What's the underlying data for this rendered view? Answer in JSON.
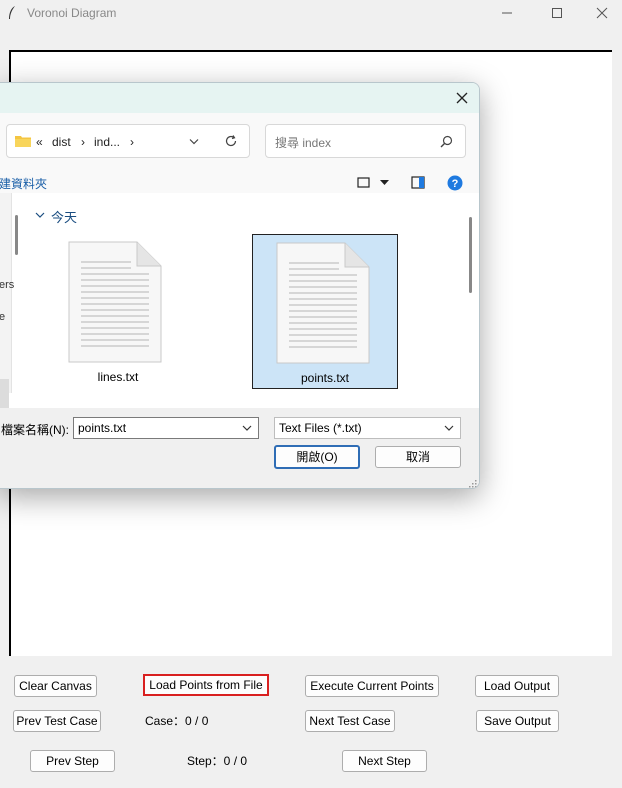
{
  "window": {
    "title": "Voronoi Diagram"
  },
  "dialog": {
    "address": {
      "prefix": "«",
      "crumbs": [
        "dist",
        "ind..."
      ],
      "separator": "›"
    },
    "search": {
      "placeholder": "搜尋 index"
    },
    "command_bar": {
      "new_folder_label": "建資料夾"
    },
    "left_pane": {
      "items": [
        "ers",
        "e"
      ]
    },
    "group": {
      "label": "今天"
    },
    "files": [
      {
        "name": "lines.txt",
        "selected": false
      },
      {
        "name": "points.txt",
        "selected": true
      }
    ],
    "filename_label": "檔案名稱(N):",
    "filename_value": "points.txt",
    "filetype_value": "Text Files (*.txt)",
    "open_label": "開啟(O)",
    "cancel_label": "取消"
  },
  "controls": {
    "clear_canvas": "Clear Canvas",
    "load_points": "Load Points from File",
    "execute_current": "Execute Current Points",
    "load_output": "Load Output",
    "prev_test_case": "Prev Test Case",
    "case_status": "Case：0 / 0",
    "next_test_case": "Next Test Case",
    "save_output": "Save Output",
    "prev_step": "Prev Step",
    "step_status": "Step：0 / 0",
    "next_step": "Next Step"
  },
  "colors": {
    "focus_outline": "#d92020",
    "selected_file_bg": "#cce4f7",
    "dialog_title_bg": "#e6f4f2",
    "accent_blue": "#2f6db5",
    "help_icon": "#1f7ae0"
  },
  "icons": [
    "feather-icon",
    "minimize-icon",
    "maximize-icon",
    "close-icon",
    "folder-icon",
    "chevron-down-icon",
    "refresh-icon",
    "search-icon",
    "view-icon",
    "preview-pane-icon",
    "help-icon",
    "text-file-icon",
    "resize-grip-icon"
  ]
}
